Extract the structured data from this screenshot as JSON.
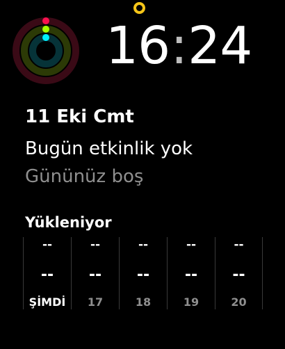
{
  "activity": {
    "icon": "activity-rings-icon",
    "colors": {
      "move": "#fa114f",
      "exercise": "#a6ff00",
      "stand": "#00f0ff"
    }
  },
  "indicator": {
    "icon": "status-ring-icon",
    "color": "#f5c518"
  },
  "time": {
    "hours": "16",
    "separator": ":",
    "minutes": "24"
  },
  "calendar": {
    "date": "11 Eki Cmt",
    "event": "Bugün etkinlik yok",
    "subtitle": "Gününüz boş"
  },
  "weather": {
    "status": "Yükleniyor",
    "forecast": [
      {
        "condition": "--",
        "temperature": "--",
        "hour": "ŞİMDİ"
      },
      {
        "condition": "--",
        "temperature": "--",
        "hour": "17"
      },
      {
        "condition": "--",
        "temperature": "--",
        "hour": "18"
      },
      {
        "condition": "--",
        "temperature": "--",
        "hour": "19"
      },
      {
        "condition": "--",
        "temperature": "--",
        "hour": "20"
      }
    ]
  }
}
